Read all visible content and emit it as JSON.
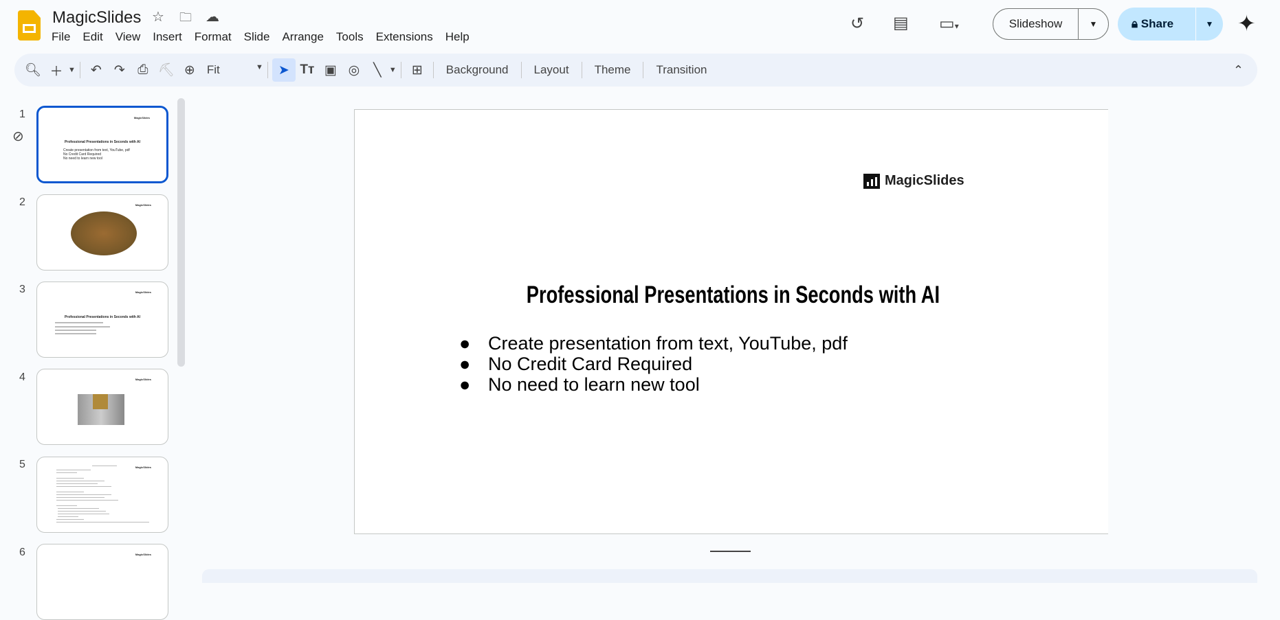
{
  "app": {
    "title": "MagicSlides",
    "accent": "#0b57d0",
    "logo_color": "#f4b400"
  },
  "menu": [
    "File",
    "Edit",
    "View",
    "Insert",
    "Format",
    "Slide",
    "Arrange",
    "Tools",
    "Extensions",
    "Help"
  ],
  "toolbar": {
    "zoom": "Fit",
    "background": "Background",
    "layout": "Layout",
    "theme": "Theme",
    "transition": "Transition"
  },
  "header": {
    "slideshow": "Slideshow",
    "share": "Share"
  },
  "filmstrip": [
    {
      "num": "1",
      "logo": "MagicSlides",
      "title": "Professional Presentations in Seconds with AI",
      "bullets": [
        "Create presentation from text, YouTube, pdf",
        "No Credit Card Required",
        "No need to learn new tool"
      ]
    },
    {
      "num": "2",
      "logo": "MagicSlides"
    },
    {
      "num": "3",
      "logo": "MagicSlides",
      "title": "Professional Presentations in Seconds with AI"
    },
    {
      "num": "4",
      "logo": "MagicSlides"
    },
    {
      "num": "5",
      "logo": "MagicSlides"
    },
    {
      "num": "6",
      "logo": "MagicSlides"
    }
  ],
  "slide": {
    "logo": "MagicSlides",
    "title": "Professional Presentations in Seconds with AI",
    "bullets": [
      "Create presentation from text, YouTube, pdf",
      "No Credit Card Required",
      "No need to learn new tool"
    ]
  }
}
